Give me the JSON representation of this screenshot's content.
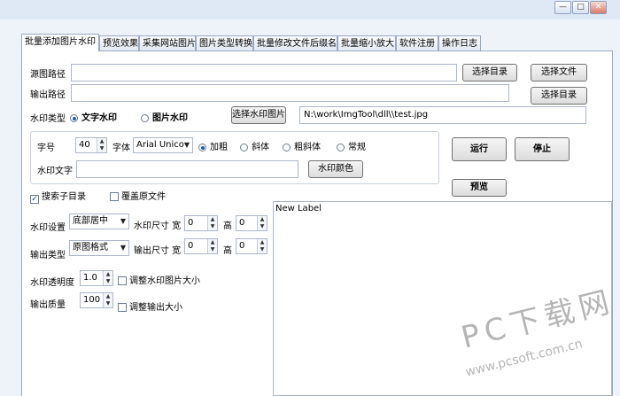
{
  "window": {
    "min_glyph": "—",
    "restore_glyph": "□",
    "close_glyph": "✕"
  },
  "tabs": [
    {
      "label": "批量添加图片水印",
      "active": true
    },
    {
      "label": "预览效果",
      "active": false
    },
    {
      "label": "采集网站图片",
      "active": false
    },
    {
      "label": "图片类型转换",
      "active": false
    },
    {
      "label": "批量修改文件后缀名",
      "active": false
    },
    {
      "label": "批量缩小放大",
      "active": false
    },
    {
      "label": "软件注册",
      "active": false
    },
    {
      "label": "操作日志",
      "active": false
    }
  ],
  "paths": {
    "source_label": "源图路径",
    "source_value": "",
    "output_label": "输出路径",
    "output_value": "",
    "select_dir_label": "选择目录",
    "select_file_label": "选择文件",
    "select_dir2_label": "选择目录"
  },
  "watermark_type": {
    "label": "水印类型",
    "text_option": "文字水印",
    "image_option": "图片水印",
    "selected": "text",
    "choose_image_label": "选择水印图片",
    "image_path": "N:\\work\\ImgTool\\dll\\\\test.jpg"
  },
  "font": {
    "size_label": "字号",
    "size_value": "40",
    "font_label": "字体",
    "font_value": "Arial Unico",
    "styles": [
      "加粗",
      "斜体",
      "粗斜体",
      "常规"
    ],
    "selected_style": "加粗",
    "text_label": "水印文字",
    "text_value": "",
    "color_button": "水印颜色"
  },
  "actions": {
    "run": "运行",
    "stop": "停止",
    "preview": "预览"
  },
  "options": {
    "search_subdirs": {
      "label": "搜索子目录",
      "checked": true
    },
    "overwrite": {
      "label": "覆盖原文件",
      "checked": false
    }
  },
  "settings": {
    "position_label": "水印设置",
    "position_value": "底部居中",
    "wm_size_label": "水印尺寸 宽",
    "wm_width": "0",
    "height_label": "高",
    "wm_height": "0",
    "output_type_label": "输出类型",
    "output_type_value": "原图格式",
    "out_size_label": "输出尺寸 宽",
    "out_width": "0",
    "out_height": "0",
    "opacity_label": "水印透明度",
    "opacity_value": "1.0",
    "adjust_wm_label": "调整水印图片大小",
    "quality_label": "输出质量",
    "quality_value": "100",
    "adjust_output_label": "调整输出大小"
  },
  "preview_label": "New Label",
  "site_watermark": {
    "cn": "PC下载网",
    "url": "www.pcsoft.com.cn"
  }
}
